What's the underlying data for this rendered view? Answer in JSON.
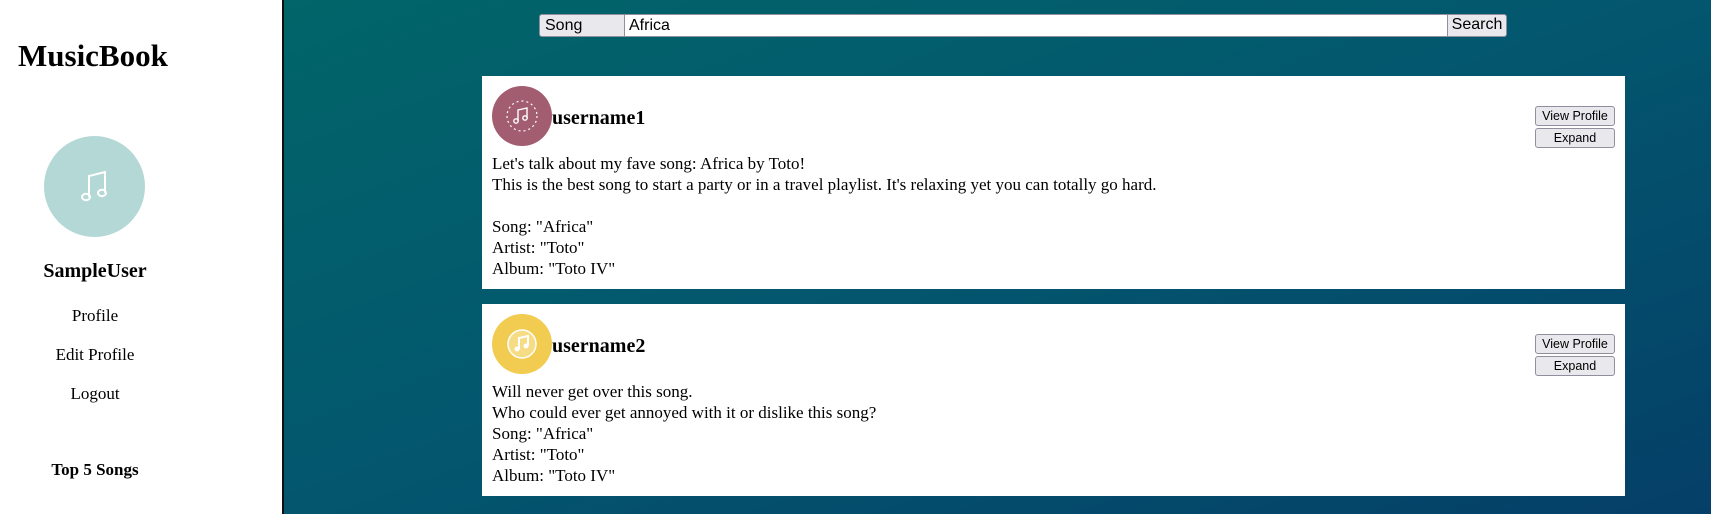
{
  "app": {
    "title": "MusicBook"
  },
  "sidebar": {
    "username": "SampleUser",
    "avatar_icon": "music-note-icon",
    "nav": [
      {
        "label": "Profile"
      },
      {
        "label": "Edit Profile"
      },
      {
        "label": "Logout"
      }
    ],
    "top5_heading": "Top 5 Songs"
  },
  "search": {
    "type_selected": "Song",
    "query": "Africa",
    "button_label": "Search"
  },
  "posts": [
    {
      "username": "username1",
      "avatar_color": "#a25d71",
      "avatar_icon": "music-note-icon",
      "body": "Let's talk about my fave song: Africa by Toto!\nThis is the best song to start a party or in a travel playlist. It's relaxing yet you can totally go hard.\n\nSong: \"Africa\"\nArtist: \"Toto\"\nAlbum: \"Toto IV\"",
      "view_profile_label": "View Profile",
      "expand_label": "Expand"
    },
    {
      "username": "username2",
      "avatar_color": "#f2cc50",
      "avatar_icon": "music-note-icon",
      "body": "Will never get over this song.\nWho could ever get annoyed with it or dislike this song?\nSong: \"Africa\"\nArtist: \"Toto\"\nAlbum: \"Toto IV\"",
      "view_profile_label": "View Profile",
      "expand_label": "Expand"
    }
  ],
  "colors": {
    "sidebar_avatar": "#b4d8d6",
    "main_bg_start": "#016569",
    "main_bg_end": "#053f68"
  }
}
